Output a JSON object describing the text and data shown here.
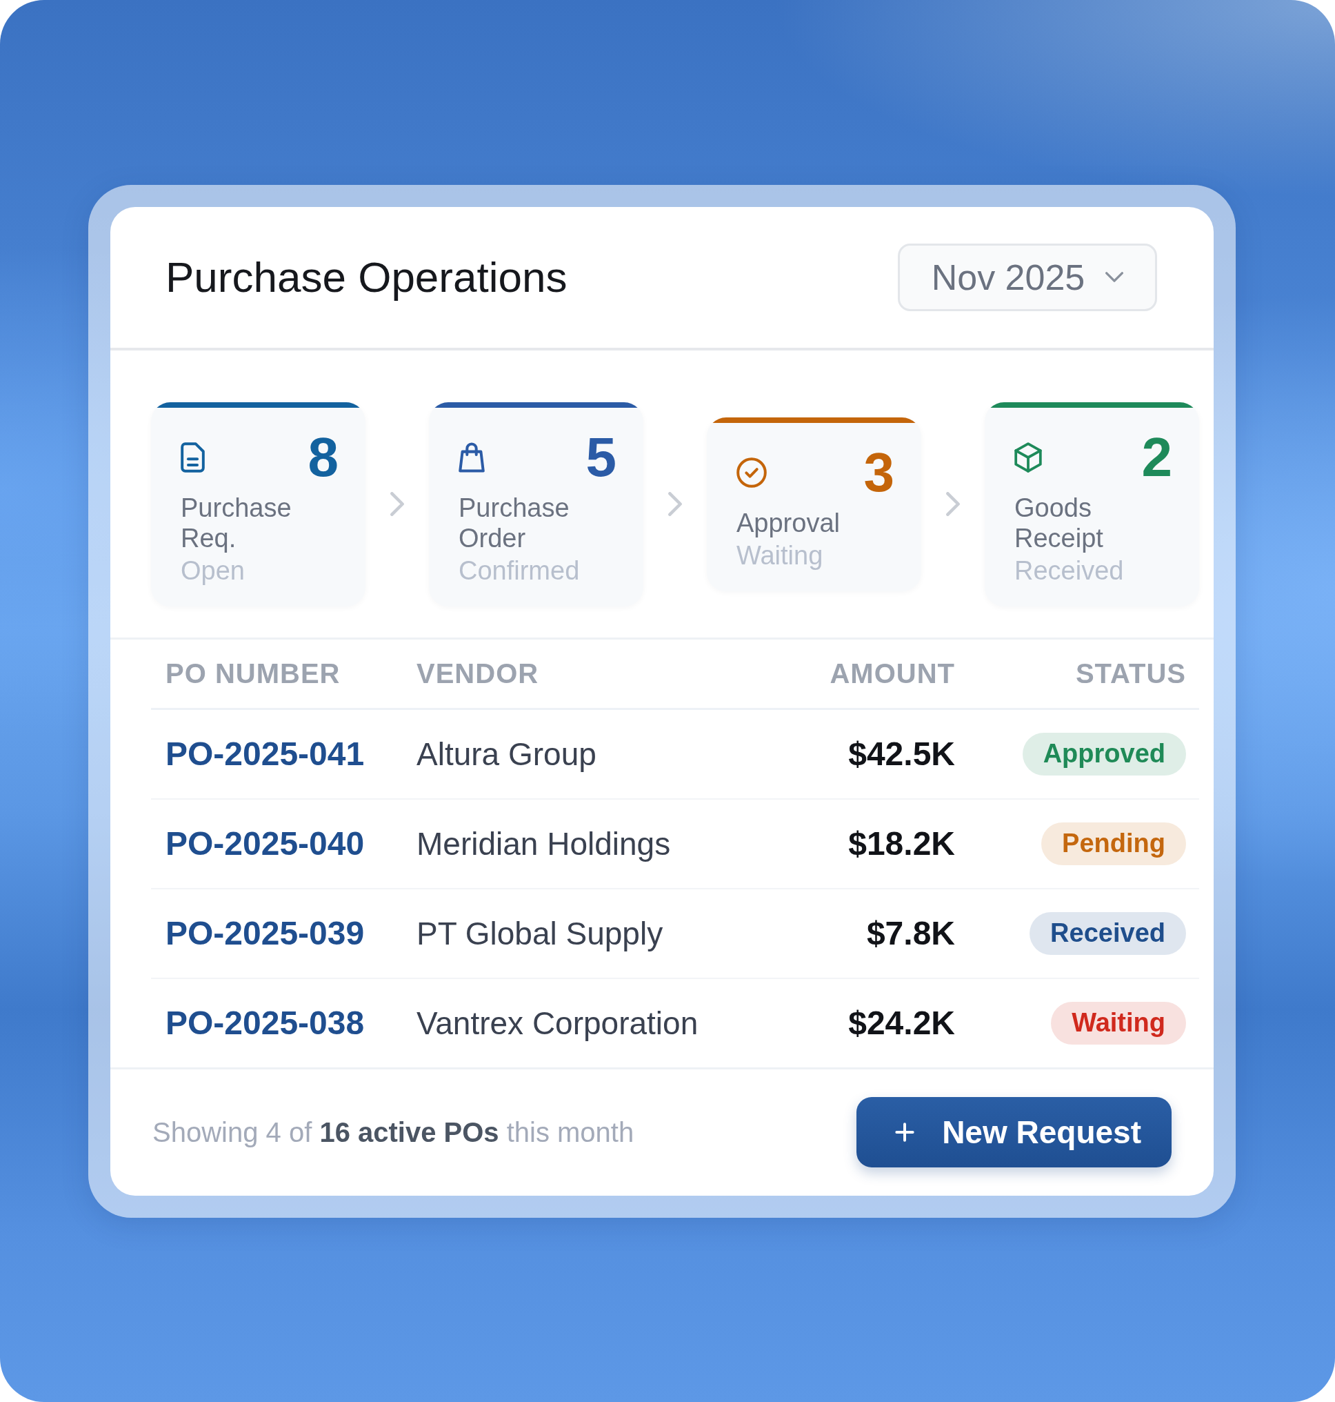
{
  "header": {
    "title": "Purchase Operations",
    "period_dropdown": {
      "value": "Nov 2025"
    }
  },
  "pipeline": [
    {
      "label": "Purchase Req.",
      "count": "8",
      "status": "Open",
      "color": "#13629f"
    },
    {
      "label": "Purchase Order",
      "count": "5",
      "status": "Confirmed",
      "color": "#2b5ba6"
    },
    {
      "label": "Approval",
      "count": "3",
      "status": "Waiting",
      "color": "#c4650a"
    },
    {
      "label": "Goods Receipt",
      "count": "2",
      "status": "Received",
      "color": "#1e8a5a"
    }
  ],
  "table": {
    "columns": [
      "PO NUMBER",
      "VENDOR",
      "AMOUNT",
      "STATUS"
    ],
    "rows": [
      {
        "po_number": "PO-2025-041",
        "vendor": "Altura Group",
        "amount": "$42.5K",
        "status": {
          "label": "Approved",
          "color": "#1f8a57"
        }
      },
      {
        "po_number": "PO-2025-040",
        "vendor": "Meridian Holdings",
        "amount": "$18.2K",
        "status": {
          "label": "Pending",
          "color": "#c4670e"
        }
      },
      {
        "po_number": "PO-2025-039",
        "vendor": "PT Global Supply",
        "amount": "$7.8K",
        "status": {
          "label": "Received",
          "color": "#1f4e8c"
        }
      },
      {
        "po_number": "PO-2025-038",
        "vendor": "Vantrex Corporation",
        "amount": "$24.2K",
        "status": {
          "label": "Waiting",
          "color": "#d0291d"
        }
      }
    ]
  },
  "footer": {
    "summary": "Showing 4 of **16 active POs** this month",
    "button": "New Request"
  }
}
